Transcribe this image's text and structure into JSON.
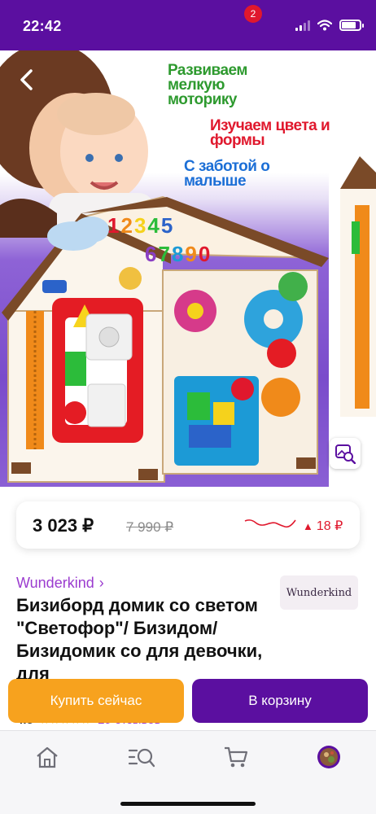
{
  "status_bar": {
    "time": "22:42"
  },
  "hero": {
    "taglines": [
      "Развиваем мелкую моторику",
      "Изучаем цвета и формы",
      "С заботой о малыше"
    ],
    "house_numbers": [
      "1",
      "2",
      "3",
      "4",
      "5",
      "6",
      "7",
      "8",
      "9",
      "0"
    ]
  },
  "price": {
    "current": "3 023 ₽",
    "old": "7 990 ₽",
    "change": "18 ₽"
  },
  "brand": {
    "link": "Wunderkind",
    "chevron": "›",
    "logo_text": "Wunderkind"
  },
  "product": {
    "title": "Бизиборд домик со светом \"Светофор\"/ Бизидом/Бизидомик со для девочки, для",
    "rating": "4.8",
    "stars": "★★★★★",
    "reviews": "29 отзывов"
  },
  "actions": {
    "buy_now": "Купить сейчас",
    "add_to_cart": "В корзину"
  },
  "tab_bar": {
    "cart_badge": "2",
    "items": [
      "home-icon",
      "catalog-search-icon",
      "cart-icon",
      "profile-avatar"
    ]
  },
  "colors": {
    "brand_purple": "#5b0fa0",
    "accent_orange": "#f7a21e",
    "price_up_red": "#e0182d",
    "brand_link": "#9b3ccf"
  }
}
